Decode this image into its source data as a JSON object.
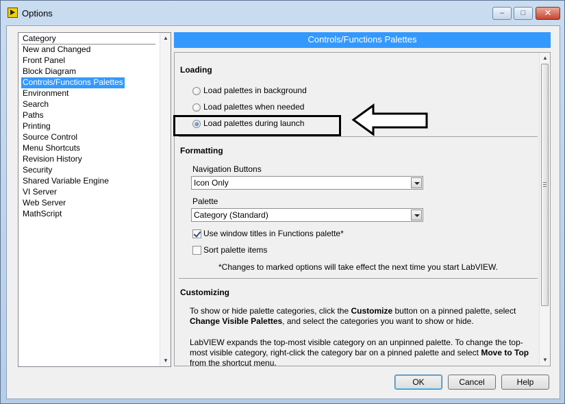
{
  "window": {
    "title": "Options",
    "minimize_glyph": "–",
    "maximize_glyph": "□",
    "close_glyph": "✕"
  },
  "categories": {
    "header": "Category",
    "items": [
      "New and Changed",
      "Front Panel",
      "Block Diagram",
      "Controls/Functions Palettes",
      "Environment",
      "Search",
      "Paths",
      "Printing",
      "Source Control",
      "Menu Shortcuts",
      "Revision History",
      "Security",
      "Shared Variable Engine",
      "VI Server",
      "Web Server",
      "MathScript"
    ],
    "selected": "Controls/Functions Palettes"
  },
  "panel": {
    "header": "Controls/Functions Palettes",
    "loading": {
      "title": "Loading",
      "options": [
        {
          "label": "Load palettes in background",
          "checked": false
        },
        {
          "label": "Load palettes when needed",
          "checked": false
        },
        {
          "label": "Load palettes during launch",
          "checked": true
        }
      ]
    },
    "formatting": {
      "title": "Formatting",
      "navigation_label": "Navigation Buttons",
      "navigation_value": "Icon Only",
      "palette_label": "Palette",
      "palette_value": "Category (Standard)",
      "use_window_titles": {
        "label": "Use window titles in Functions palette*",
        "checked": true
      },
      "sort_items": {
        "label": "Sort palette items",
        "checked": false
      },
      "note": "*Changes to marked options will take effect the next time you start LabVIEW."
    },
    "customizing": {
      "title": "Customizing",
      "p1": {
        "a": "To show or hide palette categories, click the ",
        "b": "Customize",
        "c": " button on a pinned palette, select ",
        "d": "Change Visible Palettes",
        "e": ", and select the categories you want to show or hide."
      },
      "p2": {
        "a": "LabVIEW expands the top-most visible category on an unpinned palette. To change the top-most visible category, right-click the category bar on a pinned palette and select ",
        "b": "Move to Top",
        "c": " from the shortcut menu."
      }
    }
  },
  "buttons": {
    "ok": "OK",
    "cancel": "Cancel",
    "help": "Help"
  },
  "colors": {
    "selection": "#3399ff",
    "panel_header": "#3399ff",
    "annotation": "#000000"
  }
}
